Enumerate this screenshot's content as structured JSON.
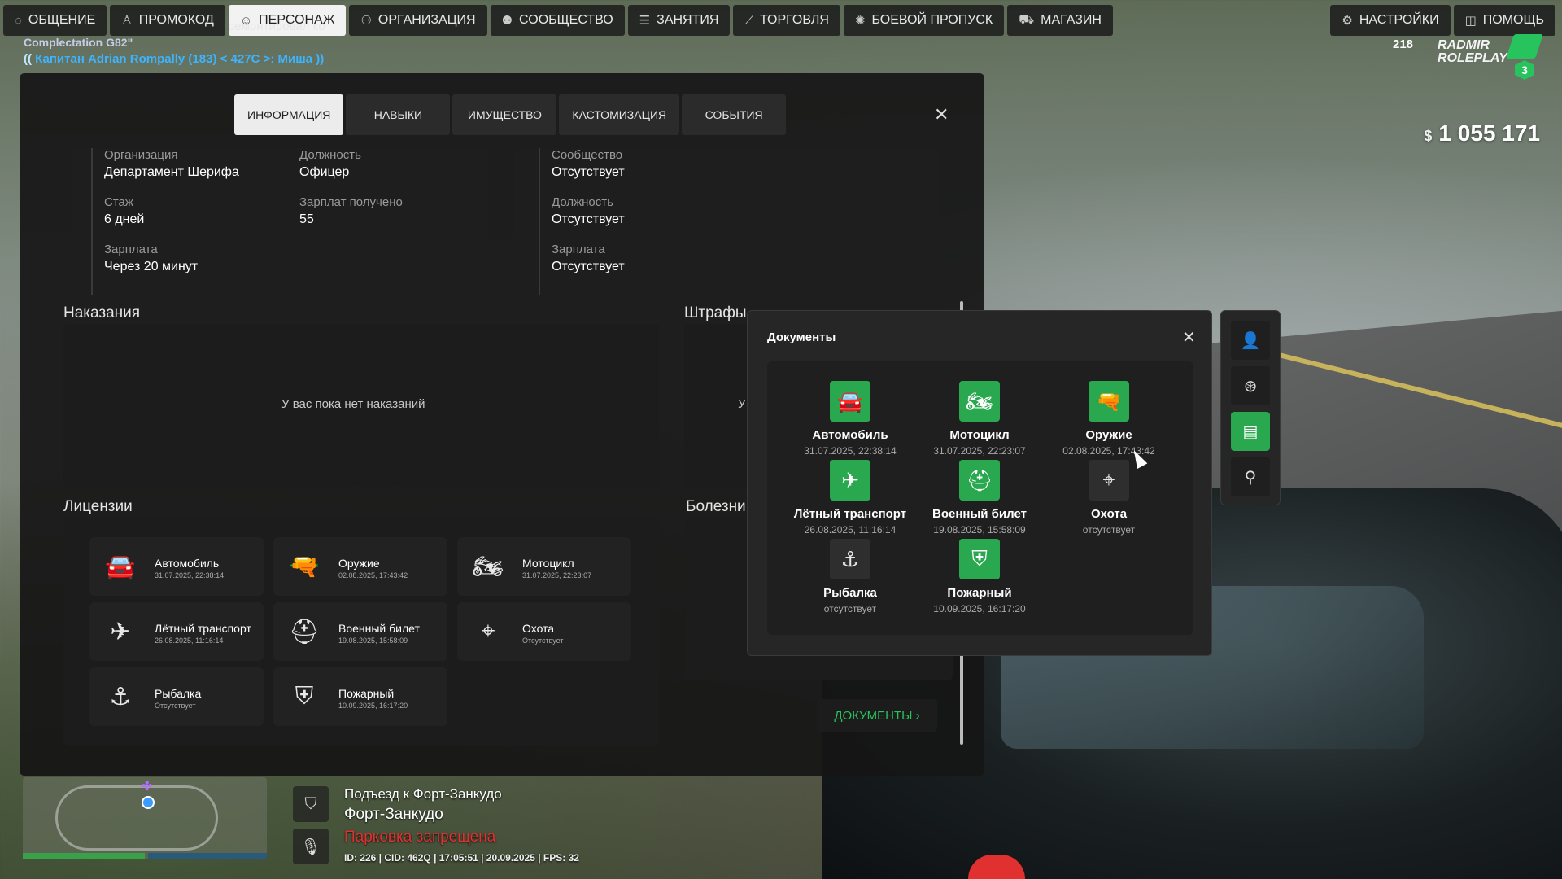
{
  "topnav": {
    "left": [
      {
        "label": "ОБЩЕНИЕ",
        "icon": "chat-icon",
        "glyph": "◌"
      },
      {
        "label": "ПРОМОКОД",
        "icon": "promo-icon",
        "glyph": "♙"
      },
      {
        "label": "ПЕРСОНАЖ",
        "icon": "user-icon",
        "glyph": "☺",
        "active": true
      },
      {
        "label": "ОРГАНИЗАЦИЯ",
        "icon": "organization-icon",
        "glyph": "⚇"
      },
      {
        "label": "СООБЩЕСТВО",
        "icon": "community-icon",
        "glyph": "⚉"
      },
      {
        "label": "ЗАНЯТИЯ",
        "icon": "activities-icon",
        "glyph": "☰"
      },
      {
        "label": "ТОРГОВЛЯ",
        "icon": "trade-icon",
        "glyph": "⟋"
      },
      {
        "label": "БОЕВОЙ ПРОПУСК",
        "icon": "battlepass-icon",
        "glyph": "✺"
      },
      {
        "label": "МАГАЗИН",
        "icon": "cart-icon",
        "glyph": "⛟"
      }
    ],
    "right": [
      {
        "label": "НАСТРОЙКИ",
        "icon": "gear-icon",
        "glyph": "⚙"
      },
      {
        "label": "ПОМОЩЬ",
        "icon": "help-icon",
        "glyph": "◫"
      }
    ]
  },
  "chat": {
    "line1": "Complectation G82\"",
    "ghost": "ремонтировал ко",
    "line2_prefix": "((",
    "line2_rank": "Капитан",
    "line2_rest": "Adrian Rompally (183) < 427C >: Миша ))"
  },
  "logo": {
    "online": "218",
    "text1": "RADMIR",
    "text2": "ROLEPLAY",
    "server": "3"
  },
  "money": {
    "currency": "$",
    "amount": "1 055 171"
  },
  "tabs": [
    {
      "label": "ИНФОРМАЦИЯ",
      "active": true
    },
    {
      "label": "НАВЫКИ"
    },
    {
      "label": "ИМУЩЕСТВО"
    },
    {
      "label": "КАСТОМИЗАЦИЯ"
    },
    {
      "label": "СОБЫТИЯ"
    }
  ],
  "org": {
    "org_label": "Организация",
    "org_value": "Департамент Шерифа",
    "pos_label": "Должность",
    "pos_value": "Офицер",
    "exp_label": "Стаж",
    "exp_value": "6 дней",
    "salrec_label": "Зарплат получено",
    "salrec_value": "55",
    "sal_label": "Зарплата",
    "sal_value": "Через 20 минут"
  },
  "community": {
    "comm_label": "Сообщество",
    "comm_value": "Отсутствует",
    "pos_label": "Должность",
    "pos_value": "Отсутствует",
    "sal_label": "Зарплата",
    "sal_value": "Отсутствует"
  },
  "punishments": {
    "title": "Наказания",
    "empty": "У вас пока нет наказаний"
  },
  "fines": {
    "title": "Штрафы",
    "empty_partial": "У"
  },
  "diseases": {
    "title": "Болезни"
  },
  "licenses": {
    "title": "Лицензии",
    "items": [
      {
        "name": "Автомобиль",
        "date": "31.07.2025, 22:38:14",
        "glyph": "🚘",
        "icon": "car-icon"
      },
      {
        "name": "Оружие",
        "date": "02.08.2025, 17:43:42",
        "glyph": "🔫",
        "icon": "weapon-icon"
      },
      {
        "name": "Мотоцикл",
        "date": "31.07.2025, 22:23:07",
        "glyph": "🏍",
        "icon": "motorcycle-icon"
      },
      {
        "name": "Лётный транспорт",
        "date": "26.08.2025, 11:16:14",
        "glyph": "✈",
        "icon": "plane-icon"
      },
      {
        "name": "Военный билет",
        "date": "19.08.2025, 15:58:09",
        "glyph": "⛑",
        "icon": "helmet-icon"
      },
      {
        "name": "Охота",
        "date": "Отсутствует",
        "glyph": "⌖",
        "icon": "crosshair-icon"
      },
      {
        "name": "Рыбалка",
        "date": "Отсутствует",
        "glyph": "⚓",
        "icon": "fishing-icon"
      },
      {
        "name": "Пожарный",
        "date": "10.09.2025, 16:17:20",
        "glyph": "⛨",
        "icon": "firefighter-icon"
      }
    ]
  },
  "docs_button": {
    "label": "ДОКУМЕНТЫ ›"
  },
  "documents": {
    "title": "Документы",
    "items": [
      {
        "name": "Автомобиль",
        "date": "31.07.2025, 22:38:14",
        "glyph": "🚘",
        "icon": "car-icon",
        "active": true
      },
      {
        "name": "Мотоцикл",
        "date": "31.07.2025, 22:23:07",
        "glyph": "🏍",
        "icon": "motorcycle-icon",
        "active": true
      },
      {
        "name": "Оружие",
        "date": "02.08.2025, 17:43:42",
        "glyph": "🔫",
        "icon": "weapon-icon",
        "active": true
      },
      {
        "name": "Лётный транспорт",
        "date": "26.08.2025, 11:16:14",
        "glyph": "✈",
        "icon": "plane-icon",
        "active": true
      },
      {
        "name": "Военный билет",
        "date": "19.08.2025, 15:58:09",
        "glyph": "⛑",
        "icon": "helmet-icon",
        "active": true
      },
      {
        "name": "Охота",
        "date": "отсутствует",
        "glyph": "⌖",
        "icon": "crosshair-icon",
        "active": false
      },
      {
        "name": "Рыбалка",
        "date": "отсутствует",
        "glyph": "⚓",
        "icon": "fishing-icon",
        "active": false
      },
      {
        "name": "Пожарный",
        "date": "10.09.2025, 16:17:20",
        "glyph": "⛨",
        "icon": "firefighter-icon",
        "active": true
      }
    ]
  },
  "rail": [
    {
      "icon": "person-icon",
      "glyph": "👤"
    },
    {
      "icon": "steering-wheel-icon",
      "glyph": "⊛"
    },
    {
      "icon": "document-icon",
      "glyph": "▤",
      "active": true
    },
    {
      "icon": "search-settings-icon",
      "glyph": "⚲"
    }
  ],
  "hud": {
    "street": "Подъезд к Форт-Занкудо",
    "area": "Форт-Занкудо",
    "parking": "Парковка запрещена",
    "status": "ID: 226 | CID: 462Q | 17:05:51 | 20.09.2025 | FPS: 32",
    "shield_glyph": "⛉",
    "mic_glyph": "🎙"
  },
  "colors": {
    "accent": "#2aa84f",
    "link": "#27c35d",
    "warning": "#e03030"
  }
}
